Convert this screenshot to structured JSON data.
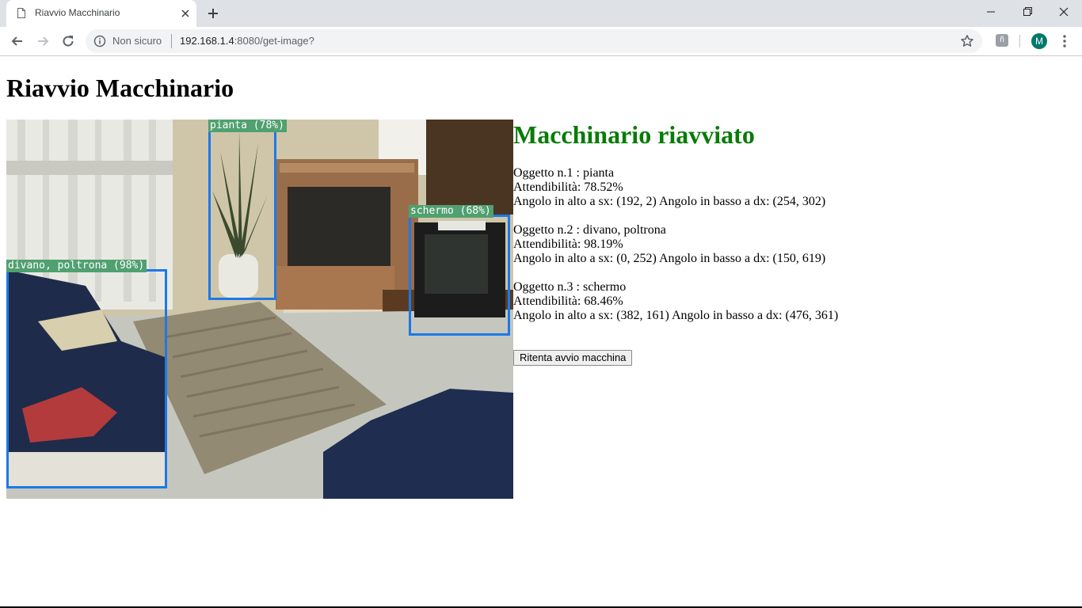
{
  "browser": {
    "tab_title": "Riavvio Macchinario",
    "security_text": "Non sicuro",
    "url_host": "192.168.1.4",
    "url_rest": ":8080/get-image?",
    "extension_glyph": "ñ",
    "profile_initial": "M",
    "profile_color": "#00796b"
  },
  "page": {
    "title": "Riavvio Macchinario",
    "status": "Macchinario riavviato",
    "status_color": "#087b08",
    "retry_button": "Ritenta avvio macchina"
  },
  "image": {
    "box_color": "#1e78e6",
    "label_color": "#50a070",
    "detections": [
      {
        "label": "pianta (78%)"
      },
      {
        "label": "schermo (68%)"
      },
      {
        "label": "divano, poltrona (98%)"
      }
    ]
  },
  "results": [
    {
      "line1": "Oggetto n.1 : pianta",
      "line2": "Attendibilità: 78.52%",
      "line3": "Angolo in alto a sx: (192, 2) Angolo in basso a dx: (254, 302)"
    },
    {
      "line1": "Oggetto n.2 : divano, poltrona",
      "line2": "Attendibilità: 98.19%",
      "line3": "Angolo in alto a sx: (0, 252) Angolo in basso a dx: (150, 619)"
    },
    {
      "line1": "Oggetto n.3 : schermo",
      "line2": "Attendibilità: 68.46%",
      "line3": "Angolo in alto a sx: (382, 161) Angolo in basso a dx: (476, 361)"
    }
  ]
}
